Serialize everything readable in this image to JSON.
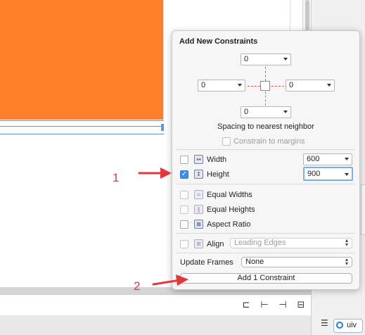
{
  "popover": {
    "title": "Add New Constraints",
    "spacing_top": "0",
    "spacing_left": "0",
    "spacing_right": "0",
    "spacing_bottom": "0",
    "spacing_caption": "Spacing to nearest neighbor",
    "constrain_margins_label": "Constrain to margins",
    "width": {
      "label": "Width",
      "value": "600",
      "checked": false
    },
    "height": {
      "label": "Height",
      "value": "900",
      "checked": true
    },
    "equal_widths_label": "Equal Widths",
    "equal_heights_label": "Equal Heights",
    "aspect_ratio_label": "Aspect Ratio",
    "align_label": "Align",
    "align_value": "Leading Edges",
    "update_frames_label": "Update Frames",
    "update_frames_value": "None",
    "add_button_label": "Add 1 Constraint"
  },
  "annotations": {
    "step1": "1",
    "step2": "2",
    "arrow_color": "#e2383b"
  },
  "canvas": {
    "view_color": "#ff7f2a"
  },
  "right_panel": {
    "chip_label": "uiv"
  },
  "icons": [
    "align-icon",
    "pin-icon",
    "resolve-icon",
    "resize-icon",
    "list-icon",
    "object-icon"
  ]
}
